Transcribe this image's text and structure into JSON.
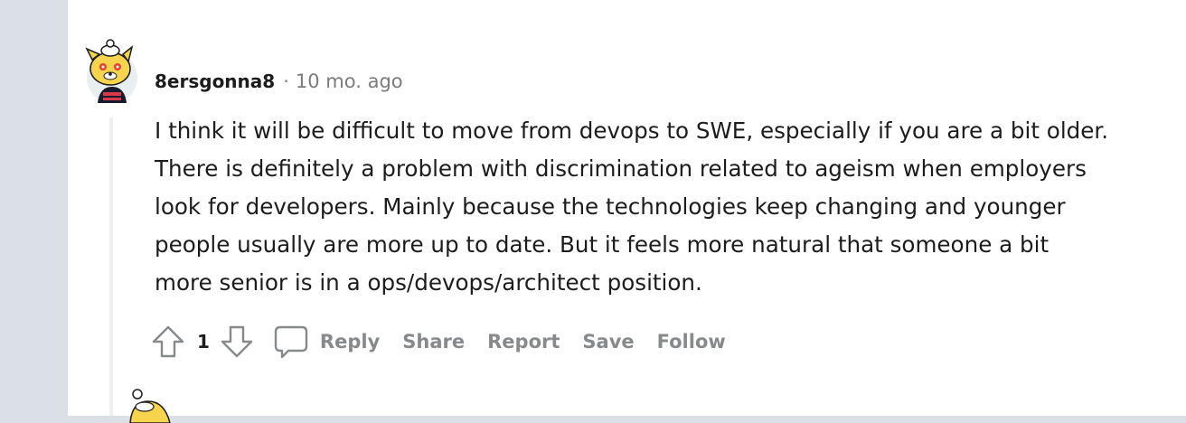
{
  "comment": {
    "author": "8ersgonna8",
    "separator": "·",
    "timestamp": "10 mo. ago",
    "body": "I think it will be difficult to move from devops to SWE, especially if you are a bit older. There is definitely a problem with discrimination related to ageism when employers look for developers. Mainly because the technologies keep changing and younger people usually are more up to date. But it feels more natural that someone a bit more senior is in a ops/devops/architect position.",
    "score": "1",
    "actions": {
      "reply": "Reply",
      "share": "Share",
      "report": "Report",
      "save": "Save",
      "follow": "Follow"
    }
  },
  "icons": {
    "upvote": "upvote-arrow-icon",
    "downvote": "downvote-arrow-icon",
    "reply": "speech-bubble-icon",
    "avatar": "snoo-avatar"
  },
  "colors": {
    "background": "#DAE0E6",
    "panel": "#FFFFFF",
    "text": "#1C1C1C",
    "muted": "#878A8C",
    "thread_line": "#EDEFF1",
    "avatar_yellow": "#F6D44E"
  }
}
